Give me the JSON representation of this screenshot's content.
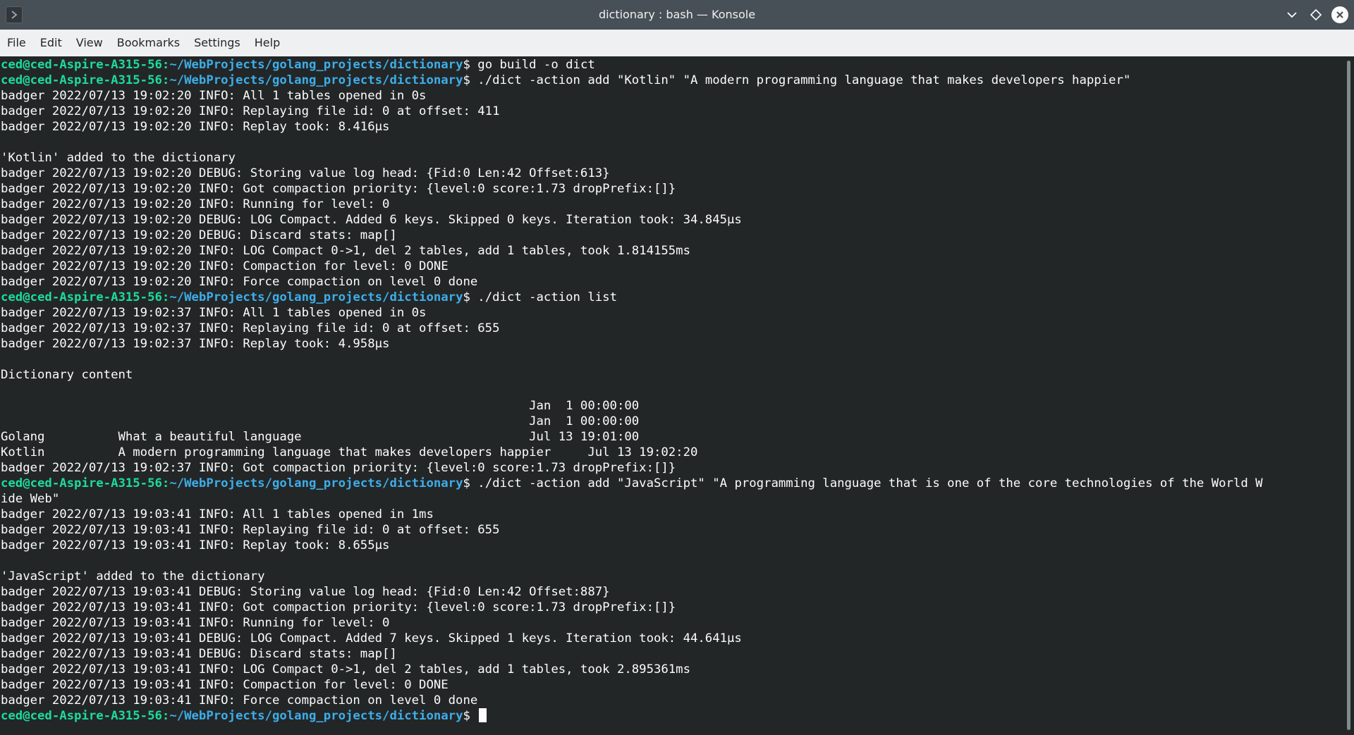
{
  "window": {
    "title": "dictionary : bash — Konsole"
  },
  "menubar": {
    "items": [
      "File",
      "Edit",
      "View",
      "Bookmarks",
      "Settings",
      "Help"
    ]
  },
  "prompt": {
    "user": "ced@ced-Aspire-A315-56",
    "path": "~/WebProjects/golang_projects/dictionary"
  },
  "terminal": {
    "lines": [
      {
        "type": "prompt",
        "cmd": " go build -o dict"
      },
      {
        "type": "prompt",
        "cmd": " ./dict -action add \"Kotlin\" \"A modern programming language that makes developers happier\""
      },
      {
        "type": "text",
        "text": "badger 2022/07/13 19:02:20 INFO: All 1 tables opened in 0s"
      },
      {
        "type": "text",
        "text": "badger 2022/07/13 19:02:20 INFO: Replaying file id: 0 at offset: 411"
      },
      {
        "type": "text",
        "text": "badger 2022/07/13 19:02:20 INFO: Replay took: 8.416µs"
      },
      {
        "type": "text",
        "text": ""
      },
      {
        "type": "text",
        "text": "'Kotlin' added to the dictionary"
      },
      {
        "type": "text",
        "text": "badger 2022/07/13 19:02:20 DEBUG: Storing value log head: {Fid:0 Len:42 Offset:613}"
      },
      {
        "type": "text",
        "text": "badger 2022/07/13 19:02:20 INFO: Got compaction priority: {level:0 score:1.73 dropPrefix:[]}"
      },
      {
        "type": "text",
        "text": "badger 2022/07/13 19:02:20 INFO: Running for level: 0"
      },
      {
        "type": "text",
        "text": "badger 2022/07/13 19:02:20 DEBUG: LOG Compact. Added 6 keys. Skipped 0 keys. Iteration took: 34.845µs"
      },
      {
        "type": "text",
        "text": "badger 2022/07/13 19:02:20 DEBUG: Discard stats: map[]"
      },
      {
        "type": "text",
        "text": "badger 2022/07/13 19:02:20 INFO: LOG Compact 0->1, del 2 tables, add 1 tables, took 1.814155ms"
      },
      {
        "type": "text",
        "text": "badger 2022/07/13 19:02:20 INFO: Compaction for level: 0 DONE"
      },
      {
        "type": "text",
        "text": "badger 2022/07/13 19:02:20 INFO: Force compaction on level 0 done"
      },
      {
        "type": "prompt",
        "cmd": " ./dict -action list"
      },
      {
        "type": "text",
        "text": "badger 2022/07/13 19:02:37 INFO: All 1 tables opened in 0s"
      },
      {
        "type": "text",
        "text": "badger 2022/07/13 19:02:37 INFO: Replaying file id: 0 at offset: 655"
      },
      {
        "type": "text",
        "text": "badger 2022/07/13 19:02:37 INFO: Replay took: 4.958µs"
      },
      {
        "type": "text",
        "text": ""
      },
      {
        "type": "text",
        "text": "Dictionary content"
      },
      {
        "type": "text",
        "text": ""
      },
      {
        "type": "text",
        "text": "                                                                        Jan  1 00:00:00"
      },
      {
        "type": "text",
        "text": "                                                                        Jan  1 00:00:00"
      },
      {
        "type": "text",
        "text": "Golang          What a beautiful language                               Jul 13 19:01:00"
      },
      {
        "type": "text",
        "text": "Kotlin          A modern programming language that makes developers happier     Jul 13 19:02:20"
      },
      {
        "type": "text",
        "text": "badger 2022/07/13 19:02:37 INFO: Got compaction priority: {level:0 score:1.73 dropPrefix:[]}"
      },
      {
        "type": "prompt",
        "cmd": " ./dict -action add \"JavaScript\" \"A programming language that is one of the core technologies of the World W"
      },
      {
        "type": "text",
        "text": "ide Web\""
      },
      {
        "type": "text",
        "text": "badger 2022/07/13 19:03:41 INFO: All 1 tables opened in 1ms"
      },
      {
        "type": "text",
        "text": "badger 2022/07/13 19:03:41 INFO: Replaying file id: 0 at offset: 655"
      },
      {
        "type": "text",
        "text": "badger 2022/07/13 19:03:41 INFO: Replay took: 8.655µs"
      },
      {
        "type": "text",
        "text": ""
      },
      {
        "type": "text",
        "text": "'JavaScript' added to the dictionary"
      },
      {
        "type": "text",
        "text": "badger 2022/07/13 19:03:41 DEBUG: Storing value log head: {Fid:0 Len:42 Offset:887}"
      },
      {
        "type": "text",
        "text": "badger 2022/07/13 19:03:41 INFO: Got compaction priority: {level:0 score:1.73 dropPrefix:[]}"
      },
      {
        "type": "text",
        "text": "badger 2022/07/13 19:03:41 INFO: Running for level: 0"
      },
      {
        "type": "text",
        "text": "badger 2022/07/13 19:03:41 DEBUG: LOG Compact. Added 7 keys. Skipped 1 keys. Iteration took: 44.641µs"
      },
      {
        "type": "text",
        "text": "badger 2022/07/13 19:03:41 DEBUG: Discard stats: map[]"
      },
      {
        "type": "text",
        "text": "badger 2022/07/13 19:03:41 INFO: LOG Compact 0->1, del 2 tables, add 1 tables, took 2.895361ms"
      },
      {
        "type": "text",
        "text": "badger 2022/07/13 19:03:41 INFO: Compaction for level: 0 DONE"
      },
      {
        "type": "text",
        "text": "badger 2022/07/13 19:03:41 INFO: Force compaction on level 0 done"
      },
      {
        "type": "prompt",
        "cmd": " ",
        "cursor": true
      }
    ]
  },
  "colors": {
    "terminal_bg": "#232627",
    "terminal_fg": "#fcfcfc",
    "prompt_user": "#1cdc9a",
    "prompt_path": "#3daee9",
    "titlebar_bg": "#475057",
    "menubar_bg": "#eff0f1"
  },
  "icons": {
    "app": "terminal-icon",
    "minimize": "chevron-down-icon",
    "maximize": "diamond-icon",
    "close": "close-icon"
  }
}
